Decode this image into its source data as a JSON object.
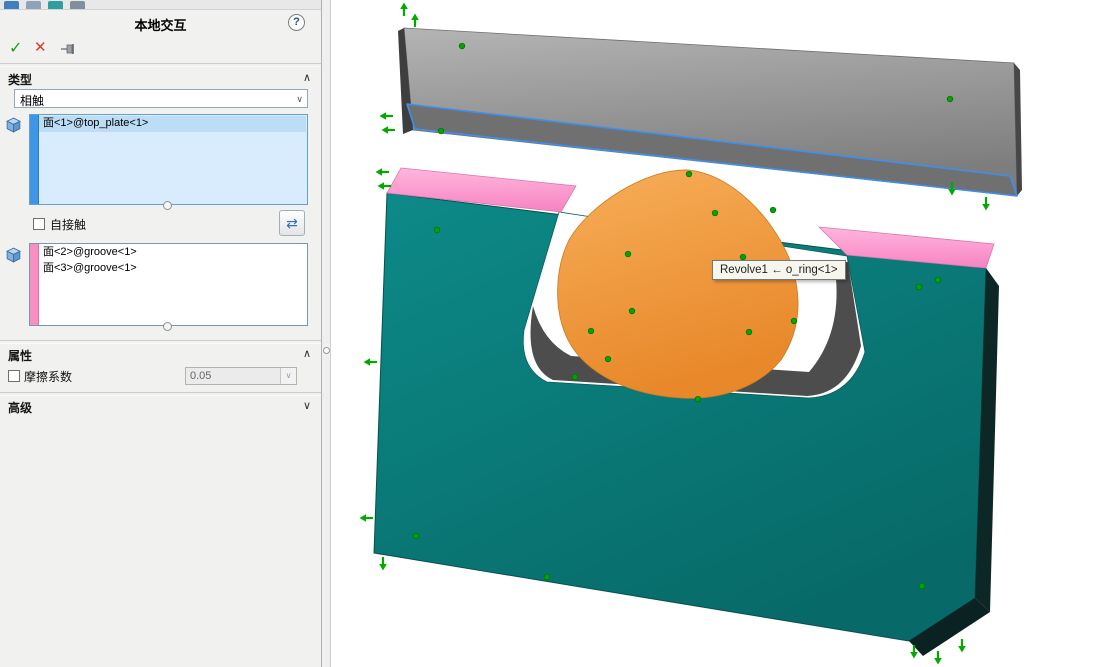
{
  "panel": {
    "title": "本地交互",
    "help_glyph": "?",
    "ok_glyph": "✓",
    "cancel_glyph": "✕",
    "type_section": {
      "label": "类型",
      "collapse_glyph": "∧",
      "contact_type": "相触",
      "dropdown_glyph": "∨",
      "selection_a": [
        "面<1>@top_plate<1>"
      ],
      "self_contact_label": "自接触",
      "swap_glyph": "⇄",
      "selection_b": [
        "面<2>@groove<1>",
        "面<3>@groove<1>"
      ]
    },
    "properties_section": {
      "label": "属性",
      "collapse_glyph": "∧",
      "friction_label": "摩擦系数",
      "friction_value": "0.05",
      "dropdown_glyph": "∨"
    },
    "advanced_section": {
      "label": "高级",
      "expand_glyph": "∨"
    }
  },
  "viewport": {
    "tooltip": "Revolve1 ← o_ring<1>"
  },
  "icons": {
    "help": "help-icon",
    "pin": "pin-icon",
    "swap": "swap-contact-faces-icon",
    "selection_cube": "face-selection-cube-icon",
    "markers": "contact-arrow-and-vertex-markers"
  },
  "colors": {
    "teal_block": "#0b7f7d",
    "orange_oring": "#ef9c42",
    "pink_face": "#fb9ed2",
    "plate_gray": "#8f8f8f",
    "selection_fill": "#d8ecfd",
    "stripe_blue": "#3f96e4",
    "stripe_pink": "#f78fc1",
    "marker_green": "#00a600",
    "selected_edge_blue": "#3d8fef"
  }
}
